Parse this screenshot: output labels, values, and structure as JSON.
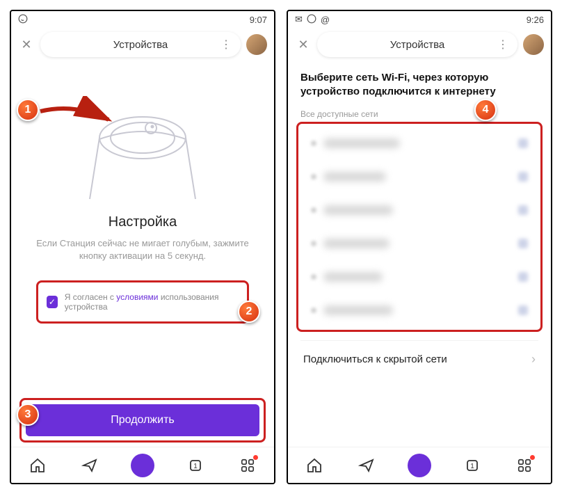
{
  "left": {
    "status": {
      "time": "9:07"
    },
    "header": {
      "title": "Устройства"
    },
    "setup": {
      "title": "Настройка",
      "subtitle": "Если Станция сейчас не мигает голубым, зажмите кнопку активации на 5 секунд."
    },
    "agree": {
      "text_before": "Я согласен с ",
      "link": "условиями",
      "text_after": " использования устройства"
    },
    "continue_label": "Продолжить"
  },
  "right": {
    "status": {
      "time": "9:26"
    },
    "header": {
      "title": "Устройства"
    },
    "heading": "Выберите сеть Wi-Fi, через которую устройство подключится к интернету",
    "networks_label": "Все доступные сети",
    "hidden_network": "Подключиться к скрытой сети"
  },
  "markers": {
    "m1": "1",
    "m2": "2",
    "m3": "3",
    "m4": "4"
  }
}
